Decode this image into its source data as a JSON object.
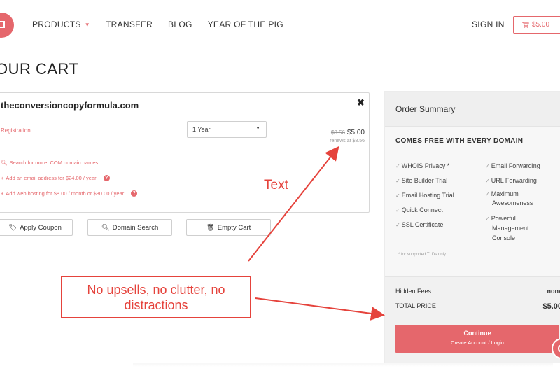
{
  "nav": {
    "items": [
      "PRODUCTS",
      "TRANSFER",
      "BLOG",
      "YEAR OF THE PIG"
    ],
    "sign_in": "SIGN IN",
    "cart_total": "$5.00"
  },
  "page": {
    "title": "OUR CART"
  },
  "cart": {
    "domain": "theconversioncopyformula.com",
    "registration_label": "Registration",
    "term_selected": "1 Year",
    "old_price": "$8.56",
    "price": "$5.00",
    "renews": "renews at $8.56",
    "links": [
      "Search for more .COM domain names.",
      "Add an email address for $24.00 / year",
      "Add web hosting for $8.00 / month or $80.00 / year"
    ],
    "buttons": {
      "apply_coupon": "Apply Coupon",
      "domain_search": "Domain Search",
      "empty_cart": "Empty Cart"
    }
  },
  "summary": {
    "title": "Order Summary",
    "free_heading": "COMES FREE WITH EVERY DOMAIN",
    "features_left": [
      "WHOIS Privacy *",
      "Site Builder Trial",
      "Email Hosting Trial",
      "Quick Connect",
      "SSL Certificate"
    ],
    "features_right": [
      "Email Forwarding",
      "URL Forwarding",
      "Maximum",
      "Awesomeness",
      "Powerful",
      "Management",
      "Console"
    ],
    "footnote": "* for supported TLDs only",
    "hidden_fees_label": "Hidden Fees",
    "hidden_fees_value": "none",
    "total_label": "TOTAL PRICE",
    "total_value": "$5.00",
    "continue_label": "Continue",
    "continue_sub": "Create Account / Login"
  },
  "annotations": {
    "text_label": "Text",
    "box_line1": "No upsells, no clutter, no",
    "box_line2": "distractions"
  },
  "colors": {
    "accent": "#e5676c",
    "annotation": "#e5433c"
  }
}
